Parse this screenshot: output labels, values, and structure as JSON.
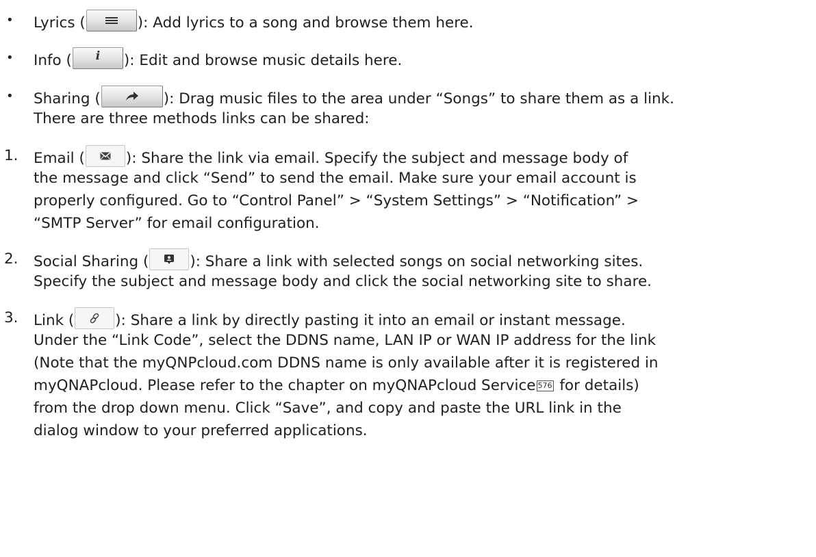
{
  "items": [
    {
      "marker": "•",
      "label": "Lyrics (",
      "after_icon": "): Add lyrics to a song and browse them here."
    },
    {
      "marker": "•",
      "label": "Info (",
      "after_icon": "): Edit and browse music details here."
    },
    {
      "marker": "•",
      "label": "Sharing (",
      "after_icon": "): Drag music files to the area under “Songs” to share them as a link.",
      "continuation": [
        "There are three methods links can be shared:"
      ]
    },
    {
      "marker": "1.",
      "label": "Email (",
      "after_icon": "): Share the link via email. Specify the subject and message body of",
      "continuation": [
        "the message and click “Send” to send the email. Make sure your email account is",
        "properly configured. Go to “Control Panel” > “System Settings” > “Notification” >",
        "“SMTP Server” for email configuration."
      ]
    },
    {
      "marker": "2.",
      "label": "Social Sharing (",
      "after_icon": "): Share a link with selected songs on social networking sites.",
      "continuation": [
        "Specify the subject and message body and click the social networking site to share."
      ]
    },
    {
      "marker": "3.",
      "label": "Link (",
      "after_icon": "): Share a link by directly pasting it into an email or instant message.",
      "continuation": [
        "Under the “Link Code”, select the DDNS name, LAN IP or WAN IP address for the link",
        "(Note that the myQNPcloud.com DDNS name is only available after it is registered in"
      ],
      "ref_line_before": "myQNAPcloud. Please refer to the chapter on myQNAPcloud Service",
      "ref_number": "576",
      "ref_line_after": " for details)",
      "final_lines": [
        "from the drop down menu. Click “Save”, and copy and paste the URL link in the",
        "dialog window to your preferred applications."
      ]
    }
  ],
  "icons": {
    "lyrics": "menu-lines-icon",
    "info": "info-i-icon",
    "sharing": "share-arrow-icon",
    "email": "envelope-icon",
    "social": "social-bubble-icon",
    "link": "chain-link-icon"
  },
  "info_glyph": "i"
}
